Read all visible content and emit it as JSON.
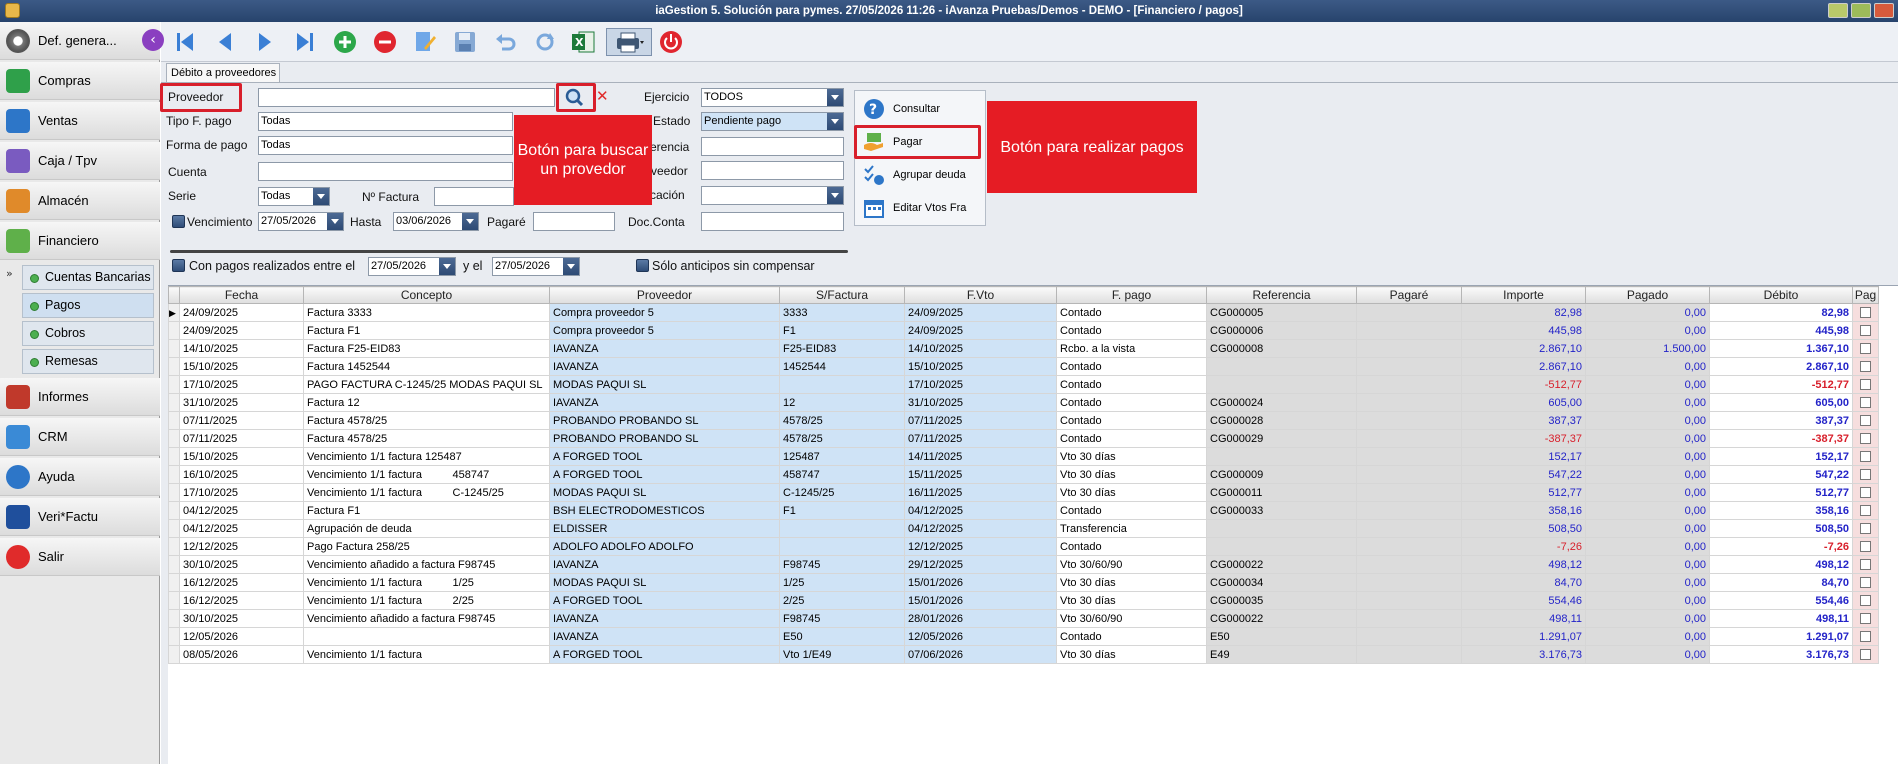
{
  "window": {
    "title": "iaGestion 5. Solución para pymes.  27/05/2026 11:26  - iAvanza Pruebas/Demos - DEMO - [Financiero / pagos]"
  },
  "sidebar": {
    "items": [
      {
        "label": "Def. genera...",
        "icon": "gear-icon"
      },
      {
        "label": "Compras",
        "icon": "cart-icon"
      },
      {
        "label": "Ventas",
        "icon": "sales-icon"
      },
      {
        "label": "Caja / Tpv",
        "icon": "cash-register-icon"
      },
      {
        "label": "Almacén",
        "icon": "warehouse-icon"
      },
      {
        "label": "Financiero",
        "icon": "money-icon"
      }
    ],
    "sub_items": [
      {
        "label": "Cuentas Bancarias"
      },
      {
        "label": "Pagos"
      },
      {
        "label": "Cobros"
      },
      {
        "label": "Remesas"
      }
    ],
    "items_bottom": [
      {
        "label": "Informes",
        "icon": "report-icon"
      },
      {
        "label": "CRM",
        "icon": "crm-icon"
      },
      {
        "label": "Ayuda",
        "icon": "help-icon"
      },
      {
        "label": "Veri*Factu",
        "icon": "verifactu-icon"
      },
      {
        "label": "Salir",
        "icon": "power-icon"
      }
    ]
  },
  "tab": {
    "label": "Débito a proveedores"
  },
  "filters": {
    "proveedor_label": "Proveedor",
    "tipo_pago_label": "Tipo F. pago",
    "tipo_pago_value": "Todas",
    "forma_pago_label": "Forma de pago",
    "forma_pago_value": "Todas",
    "cuenta_label": "Cuenta",
    "serie_label": "Serie",
    "serie_value": "Todas",
    "nfactura_label": "Nº Factura",
    "vencimiento_label": "Vencimiento",
    "vencimiento_from": "27/05/2026",
    "hasta_label": "Hasta",
    "vencimiento_to": "03/06/2026",
    "pagare_label": "Pagaré",
    "ejercicio_label": "Ejercicio",
    "ejercicio_value": "TODOS",
    "estado_label": "Estado",
    "estado_value": "Pendiente pago",
    "referencia_label": "erencia",
    "proveedor2_label": "veedor",
    "ubicacion_label": "cación",
    "docconta_label": "Doc.Conta",
    "con_pagos_label": "Con pagos realizados entre el",
    "con_pagos_from": "27/05/2026",
    "y_el_label": "y el",
    "con_pagos_to": "27/05/2026",
    "solo_anticipos_label": "Sólo anticipos sin compensar"
  },
  "actions": {
    "consultar": "Consultar",
    "pagar": "Pagar",
    "agrupar": "Agrupar deuda",
    "editar": "Editar Vtos Fra"
  },
  "callouts": {
    "buscar": "Botón para buscar un provedor",
    "pagar": "Botón para realizar pagos"
  },
  "table": {
    "headers": [
      "Fecha",
      "Concepto",
      "Proveedor",
      "S/Factura",
      "F.Vto",
      "F. pago",
      "Referencia",
      "Pagaré",
      "Importe",
      "Pagado",
      "Débito",
      "Pag"
    ],
    "rows": [
      [
        "24/09/2025",
        "Factura 3333",
        "Compra proveedor 5",
        "3333",
        "24/09/2025",
        "Contado",
        "CG000005",
        "",
        "82,98",
        "0,00",
        "82,98"
      ],
      [
        "24/09/2025",
        "Factura F1",
        "Compra proveedor 5",
        "F1",
        "24/09/2025",
        "Contado",
        "CG000006",
        "",
        "445,98",
        "0,00",
        "445,98"
      ],
      [
        "14/10/2025",
        "Factura F25-EID83",
        "IAVANZA",
        "F25-EID83",
        "14/10/2025",
        "Rcbo. a la vista",
        "CG000008",
        "",
        "2.867,10",
        "1.500,00",
        "1.367,10"
      ],
      [
        "15/10/2025",
        "Factura 1452544",
        "IAVANZA",
        "1452544",
        "15/10/2025",
        "Contado",
        "",
        "",
        "2.867,10",
        "0,00",
        "2.867,10"
      ],
      [
        "17/10/2025",
        "PAGO FACTURA C-1245/25 MODAS PAQUI SL",
        "MODAS PAQUI SL",
        "",
        "17/10/2025",
        "Contado",
        "",
        "",
        "-512,77",
        "0,00",
        "-512,77"
      ],
      [
        "31/10/2025",
        "Factura 12",
        "IAVANZA",
        "12",
        "31/10/2025",
        "Contado",
        "CG000024",
        "",
        "605,00",
        "0,00",
        "605,00"
      ],
      [
        "07/11/2025",
        "Factura 4578/25",
        "PROBANDO PROBANDO SL",
        "4578/25",
        "07/11/2025",
        "Contado",
        "CG000028",
        "",
        "387,37",
        "0,00",
        "387,37"
      ],
      [
        "07/11/2025",
        "Factura 4578/25",
        "PROBANDO PROBANDO SL",
        "4578/25",
        "07/11/2025",
        "Contado",
        "CG000029",
        "",
        "-387,37",
        "0,00",
        "-387,37"
      ],
      [
        "15/10/2025",
        "Vencimiento 1/1 factura 125487",
        "A FORGED TOOL",
        "125487",
        "14/11/2025",
        "Vto 30 días",
        "",
        "",
        "152,17",
        "0,00",
        "152,17"
      ],
      [
        "16/10/2025",
        "Vencimiento 1/1 factura          458747",
        "A FORGED TOOL",
        "458747",
        "15/11/2025",
        "Vto 30 días",
        "CG000009",
        "",
        "547,22",
        "0,00",
        "547,22"
      ],
      [
        "17/10/2025",
        "Vencimiento 1/1 factura          C-1245/25",
        "MODAS PAQUI SL",
        "C-1245/25",
        "16/11/2025",
        "Vto 30 días",
        "CG000011",
        "",
        "512,77",
        "0,00",
        "512,77"
      ],
      [
        "04/12/2025",
        "Factura F1",
        "BSH ELECTRODOMESTICOS",
        "F1",
        "04/12/2025",
        "Contado",
        "CG000033",
        "",
        "358,16",
        "0,00",
        "358,16"
      ],
      [
        "04/12/2025",
        "Agrupación de deuda",
        "ELDISSER",
        "",
        "04/12/2025",
        "Transferencia",
        "",
        "",
        "508,50",
        "0,00",
        "508,50"
      ],
      [
        "12/12/2025",
        "Pago Factura 258/25",
        "ADOLFO ADOLFO ADOLFO",
        "",
        "12/12/2025",
        "Contado",
        "",
        "",
        "-7,26",
        "0,00",
        "-7,26"
      ],
      [
        "30/10/2025",
        "Vencimiento añadido a factura F98745",
        "IAVANZA",
        "F98745",
        "29/12/2025",
        "Vto 30/60/90",
        "CG000022",
        "",
        "498,12",
        "0,00",
        "498,12"
      ],
      [
        "16/12/2025",
        "Vencimiento 1/1 factura          1/25",
        "MODAS PAQUI SL",
        "1/25",
        "15/01/2026",
        "Vto 30 días",
        "CG000034",
        "",
        "84,70",
        "0,00",
        "84,70"
      ],
      [
        "16/12/2025",
        "Vencimiento 1/1 factura          2/25",
        "A FORGED TOOL",
        "2/25",
        "15/01/2026",
        "Vto 30 días",
        "CG000035",
        "",
        "554,46",
        "0,00",
        "554,46"
      ],
      [
        "30/10/2025",
        "Vencimiento añadido a factura F98745",
        "IAVANZA",
        "F98745",
        "28/01/2026",
        "Vto 30/60/90",
        "CG000022",
        "",
        "498,11",
        "0,00",
        "498,11"
      ],
      [
        "12/05/2026",
        "",
        "IAVANZA",
        "E50",
        "12/05/2026",
        "Contado",
        "E50",
        "",
        "1.291,07",
        "0,00",
        "1.291,07"
      ],
      [
        "08/05/2026",
        "Vencimiento 1/1 factura",
        "A FORGED TOOL",
        "Vto 1/E49",
        "07/06/2026",
        "Vto 30 días",
        "E49",
        "",
        "3.176,73",
        "0,00",
        "3.176,73"
      ]
    ]
  },
  "colors": {
    "accent_red": "#e51c24",
    "titlebar": "#27436c",
    "grid_blue": "#cfe3f6"
  }
}
